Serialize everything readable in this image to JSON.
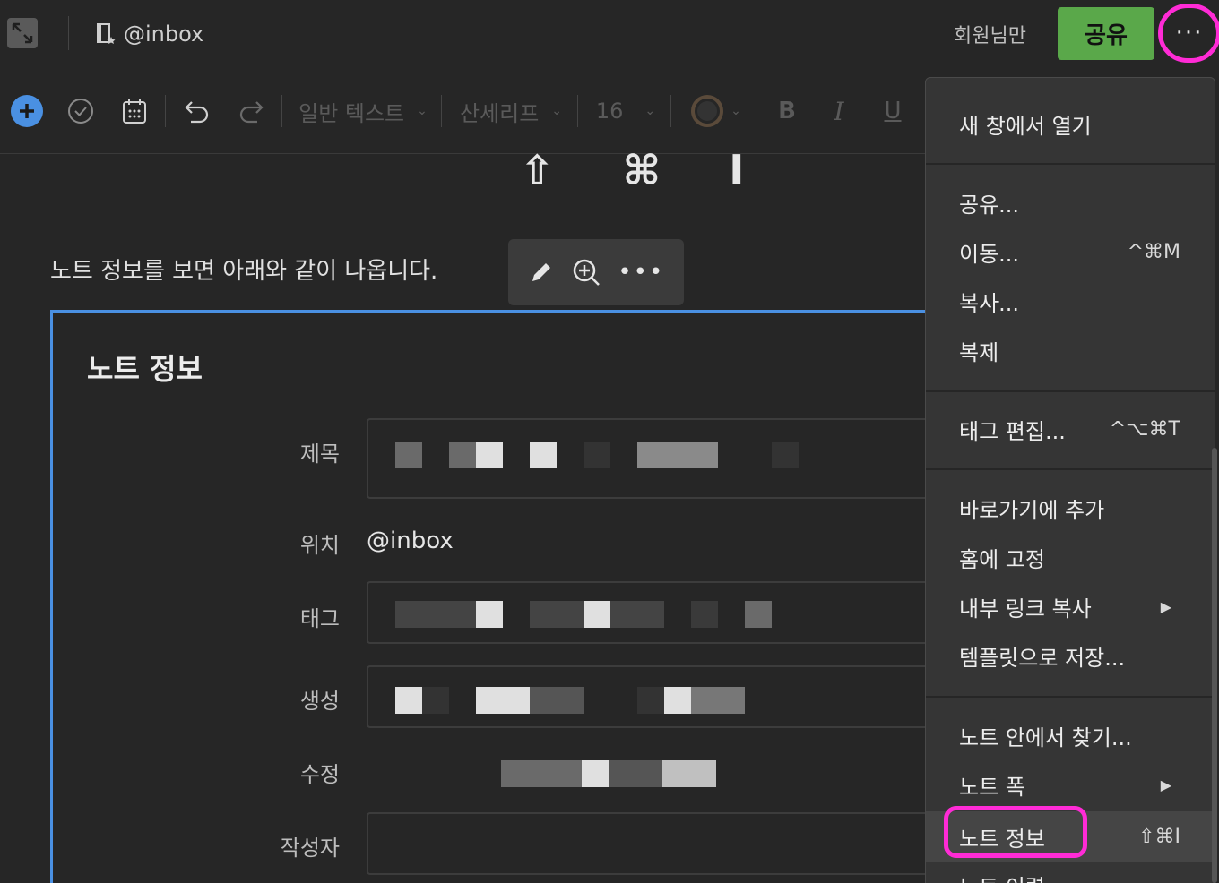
{
  "topbar": {
    "notebook": "@inbox",
    "member_label": "회원님만",
    "share_label": "공유",
    "more_label": "···"
  },
  "toolbar": {
    "text_style": "일반 텍스트",
    "font": "산세리프",
    "font_size": "16",
    "bold": "B",
    "italic": "I",
    "underline": "U"
  },
  "content": {
    "shortcut_hint": "⇧ ⌘ I",
    "paragraph": "노트 정보를 보면 아래와 같이 나옵니다."
  },
  "note_info": {
    "title": "노트 정보",
    "labels": {
      "title": "제목",
      "location": "위치",
      "tags": "태그",
      "created": "생성",
      "modified": "수정",
      "author": "작성자"
    },
    "location_value": "@inbox"
  },
  "menu": {
    "items": [
      {
        "label": "새 창에서 열기",
        "shortcut": ""
      },
      {
        "label": "공유...",
        "shortcut": ""
      },
      {
        "label": "이동...",
        "shortcut": "^⌘M"
      },
      {
        "label": "복사...",
        "shortcut": ""
      },
      {
        "label": "복제",
        "shortcut": ""
      },
      {
        "label": "태그 편집...",
        "shortcut": "^⌥⌘T"
      },
      {
        "label": "바로가기에 추가",
        "shortcut": ""
      },
      {
        "label": "홈에 고정",
        "shortcut": ""
      },
      {
        "label": "내부 링크 복사",
        "shortcut": ""
      },
      {
        "label": "템플릿으로 저장...",
        "shortcut": ""
      },
      {
        "label": "노트 안에서 찾기...",
        "shortcut": ""
      },
      {
        "label": "노트 폭",
        "shortcut": ""
      },
      {
        "label": "노트 정보",
        "shortcut": "⇧⌘I"
      },
      {
        "label": "노트 이력",
        "shortcut": ""
      }
    ]
  },
  "colors": {
    "accent_green": "#5aa84a",
    "highlight_pink": "#ff2bd6",
    "panel_blue": "#4a90e2"
  }
}
